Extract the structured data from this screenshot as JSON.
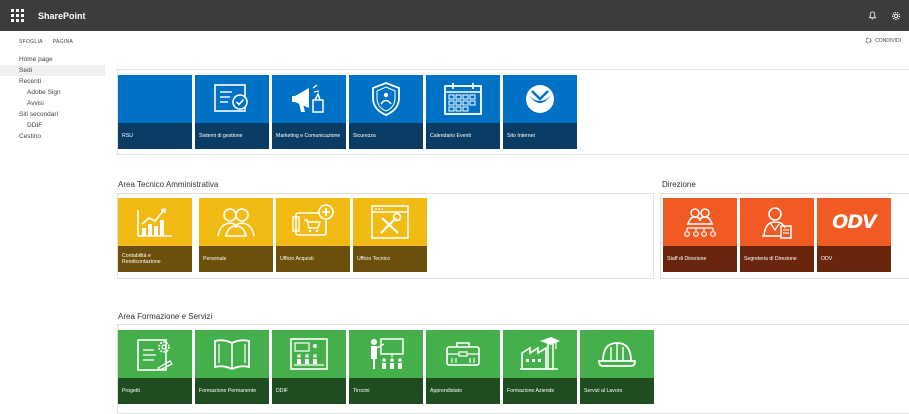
{
  "app": {
    "brand": "SharePoint"
  },
  "suite_icons": [
    "bell-icon",
    "gear-icon"
  ],
  "command_bar": {
    "left": [
      "SFOGLIA",
      "PAGINA"
    ],
    "share_label": "CONDIVIDI"
  },
  "nav": [
    {
      "label": "Home page",
      "level": 0,
      "selected": false
    },
    {
      "label": "Sedi",
      "level": 0,
      "selected": true
    },
    {
      "label": "Recenti",
      "level": 0,
      "selected": false
    },
    {
      "label": "Adobe Sign",
      "level": 1,
      "selected": false
    },
    {
      "label": "Avvisi",
      "level": 1,
      "selected": false
    },
    {
      "label": "Siti secondari",
      "level": 0,
      "selected": false
    },
    {
      "label": "DDIF",
      "level": 1,
      "selected": false
    },
    {
      "label": "Cestino",
      "level": 0,
      "selected": false
    }
  ],
  "sections": {
    "top": {
      "title": "",
      "tiles": [
        {
          "label": "RSU",
          "icon": "blank-icon"
        },
        {
          "label": "Sistemi di gestione",
          "icon": "certificate-icon"
        },
        {
          "label": "Marketing e Comunicazione",
          "icon": "megaphone-icon"
        },
        {
          "label": "Sicurezza",
          "icon": "shield-icon"
        },
        {
          "label": "Calendario Eventi",
          "icon": "calendar-icon"
        },
        {
          "label": "Sito Internet",
          "icon": "globe-logo-icon"
        }
      ]
    },
    "tecnico": {
      "title": "Area Tecnico Amministrativa",
      "tiles": [
        {
          "label": "Contabilità e Rendicontazione",
          "icon": "chart-icon"
        },
        {
          "label": "Personale",
          "icon": "people-icon"
        },
        {
          "label": "Ufficio Acquisti",
          "icon": "cart-icon"
        },
        {
          "label": "Ufficio Tecnico",
          "icon": "tools-icon"
        }
      ]
    },
    "direzione": {
      "title": "Direzione",
      "tiles": [
        {
          "label": "Staff di Direzione",
          "icon": "org-chart-icon"
        },
        {
          "label": "Segreteria di Direzione",
          "icon": "secretary-icon"
        },
        {
          "label": "ODV",
          "icon": "odv-logo-icon",
          "logo_text": "ODV"
        }
      ]
    },
    "formazione": {
      "title": "Area Formazione e Servizi",
      "tiles": [
        {
          "label": "Progetti",
          "icon": "project-icon"
        },
        {
          "label": "Formazione Permanente",
          "icon": "book-icon"
        },
        {
          "label": "DDIF",
          "icon": "classroom-icon"
        },
        {
          "label": "Tirocini",
          "icon": "presentation-icon"
        },
        {
          "label": "Apprendistato",
          "icon": "toolbox-icon"
        },
        {
          "label": "Formazione Aziende",
          "icon": "factory-icon"
        },
        {
          "label": "Servizi al Lavoro",
          "icon": "helmet-icon"
        }
      ]
    }
  },
  "colors": {
    "suitebar": "#3c3c3c",
    "blue": "#0072c6",
    "yellow": "#f2bb13",
    "orange": "#f15a22",
    "green": "#45b04b"
  }
}
